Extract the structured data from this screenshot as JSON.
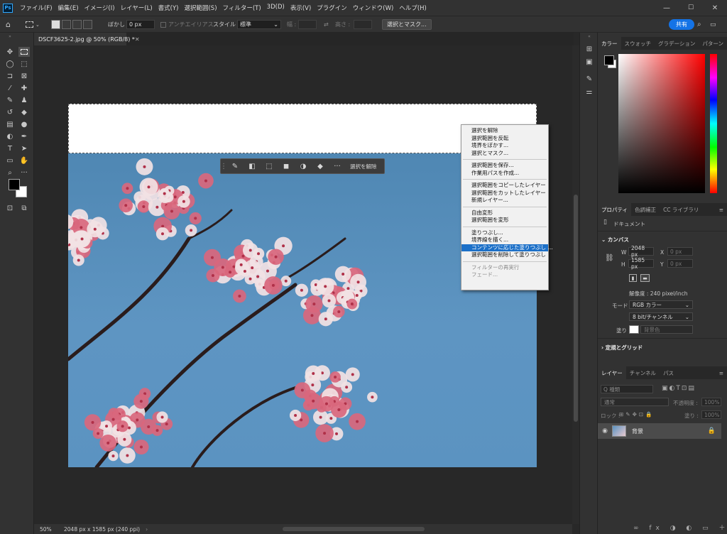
{
  "app": {
    "logo": "Ps"
  },
  "menu": [
    "ファイル(F)",
    "編集(E)",
    "イメージ(I)",
    "レイヤー(L)",
    "書式(Y)",
    "選択範囲(S)",
    "フィルター(T)",
    "3D(D)",
    "表示(V)",
    "プラグイン",
    "ウィンドウ(W)",
    "ヘルプ(H)"
  ],
  "window_controls": {
    "minimize": "—",
    "maximize": "☐",
    "close": "✕"
  },
  "options": {
    "feather_label": "ぼかし :",
    "feather_value": "0 px",
    "antialias_label": "アンチエイリアス",
    "style_label": "スタイル :",
    "style_value": "標準",
    "width_label": "幅 :",
    "height_label": "高さ :",
    "select_mask_button": "選択とマスク..."
  },
  "top_right": {
    "share_button": "共有"
  },
  "document": {
    "tab_title": "DSCF3625-2.jpg @ 50% (RGB/8) *",
    "tab_close": "✕"
  },
  "status": {
    "zoom": "50%",
    "dimensions": "2048 px x 1585 px (240 ppi)"
  },
  "context_toolbar": {
    "deselect_label": "選択を解除"
  },
  "context_menu": {
    "groups": [
      [
        "選択を解除",
        "選択範囲を反転",
        "境界をぼかす...",
        "選択とマスク..."
      ],
      [
        "選択範囲を保存...",
        "作業用パスを作成..."
      ],
      [
        "選択範囲をコピーしたレイヤー",
        "選択範囲をカットしたレイヤー",
        "新規レイヤー..."
      ],
      [
        "自由変形",
        "選択範囲を変形"
      ],
      [
        "塗りつぶし...",
        "境界線を描く...",
        "コンテンツに応じた塗りつぶし ...",
        "選択範囲を削除して塗りつぶし"
      ],
      [
        "フィルターの再実行",
        "フェード..."
      ]
    ],
    "highlighted": "コンテンツに応じた塗りつぶし ...",
    "disabled": [
      "フィルターの再実行",
      "フェード..."
    ]
  },
  "color_panel": {
    "tabs": [
      "カラー",
      "スウォッチ",
      "グラデーション",
      "パターン"
    ],
    "active_tab": "カラー",
    "field_hue_color": "#ff0000"
  },
  "properties_panel": {
    "tabs": [
      "プロパティ",
      "色調補正",
      "CC ライブラリ"
    ],
    "active_tab": "プロパティ",
    "doc_label": "ドキュメント",
    "canvas_section": "カンバス",
    "w_label": "W",
    "w_value": "2048 px",
    "h_label": "H",
    "h_value": "1585 px",
    "x_label": "X",
    "x_value": "0 px",
    "y_label": "Y",
    "y_value": "0 px",
    "resolution": "解像度 : 240 pixel/inch",
    "mode_label": "モード",
    "mode_value": "RGB カラー",
    "depth_value": "8 bit/チャンネル",
    "fill_label": "塗り",
    "fill_value": "背景色",
    "rulers_section": "定規とグリッド"
  },
  "layers_panel": {
    "tabs": [
      "レイヤー",
      "チャンネル",
      "パス"
    ],
    "active_tab": "レイヤー",
    "search_placeholder": "Q 種類",
    "blend_mode": "通常",
    "opacity_label": "不透明度 :",
    "opacity_value": "100%",
    "lock_label": "ロック :",
    "fill_label": "塗り :",
    "fill_value": "100%",
    "layers": [
      {
        "name": "背景",
        "locked": true,
        "visible": true
      }
    ]
  }
}
